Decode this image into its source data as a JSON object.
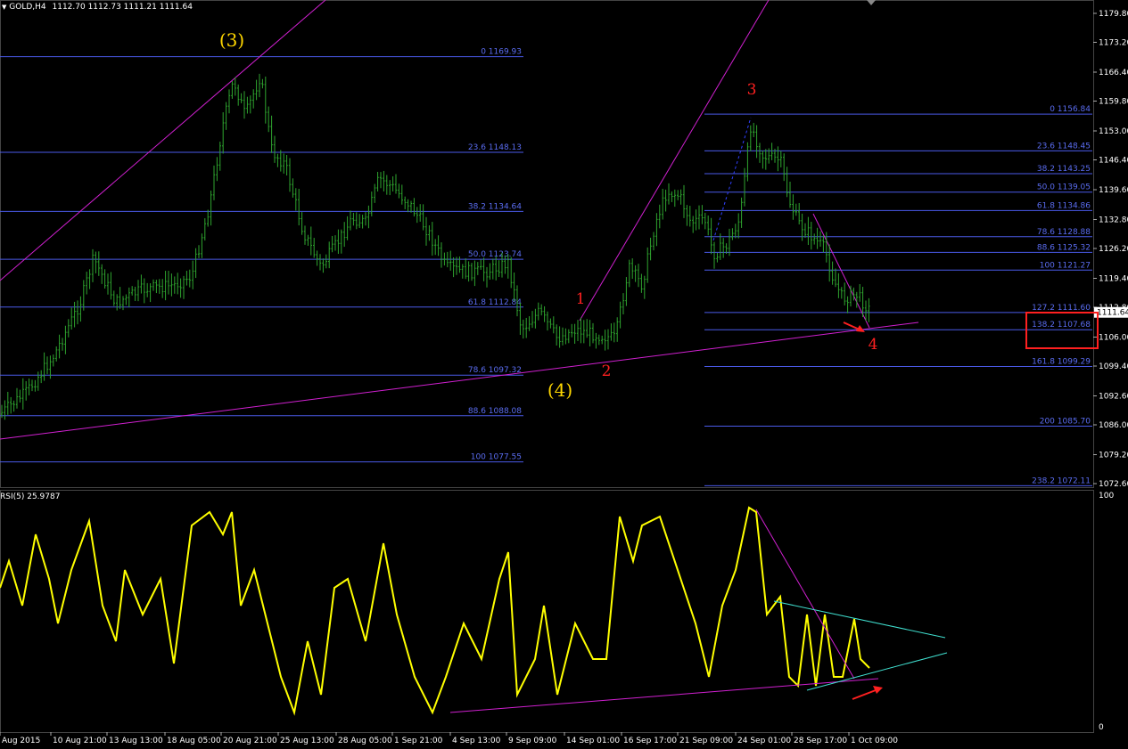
{
  "header": {
    "symbol": "GOLD,H4",
    "ohlc": "1112.70 1112.73 1111.21 1111.64"
  },
  "rsi_header": "RSI(5) 25.9787",
  "colors": {
    "background": "#000000",
    "candle": "#2fa52f",
    "fib": "#4a5ae8",
    "trend": "#d020d0",
    "rsi": "#ffff00",
    "rsi_trend2": "#40e0d0",
    "annotation": "#ff2020",
    "wave_label": "#ffd700"
  },
  "price_axis": [
    "1179.80",
    "1173.20",
    "1166.40",
    "1159.80",
    "1153.00",
    "1146.40",
    "1139.60",
    "1132.80",
    "1126.20",
    "1119.40",
    "1112.80",
    "1106.00",
    "1099.40",
    "1092.60",
    "1086.00",
    "1079.20",
    "1072.60"
  ],
  "current_price_tag": "1111.64",
  "rsi_axis": [
    "100",
    "0"
  ],
  "time_axis": [
    "Aug 2015",
    "10 Aug 21:00",
    "13 Aug 13:00",
    "18 Aug 05:00",
    "20 Aug 21:00",
    "25 Aug 13:00",
    "28 Aug 05:00",
    "1 Sep 21:00",
    "4 Sep 13:00",
    "9 Sep 09:00",
    "14 Sep 01:00",
    "16 Sep 17:00",
    "21 Sep 09:00",
    "24 Sep 01:00",
    "28 Sep 17:00",
    "1 Oct 09:00"
  ],
  "fib_left": [
    {
      "label": "0 1169.93",
      "price": 1169.93
    },
    {
      "label": "23.6 1148.13",
      "price": 1148.13
    },
    {
      "label": "38.2 1134.64",
      "price": 1134.64
    },
    {
      "label": "50.0 1123.74",
      "price": 1123.74
    },
    {
      "label": "61.8 1112.84",
      "price": 1112.84
    },
    {
      "label": "78.6 1097.32",
      "price": 1097.32
    },
    {
      "label": "88.6 1088.08",
      "price": 1088.08
    },
    {
      "label": "100 1077.55",
      "price": 1077.55
    }
  ],
  "fib_right": [
    {
      "label": "0 1156.84",
      "price": 1156.84
    },
    {
      "label": "23.6 1148.45",
      "price": 1148.45
    },
    {
      "label": "38.2 1143.25",
      "price": 1143.25
    },
    {
      "label": "50.0 1139.05",
      "price": 1139.05
    },
    {
      "label": "61.8 1134.86",
      "price": 1134.86
    },
    {
      "label": "78.6 1128.88",
      "price": 1128.88
    },
    {
      "label": "88.6 1125.32",
      "price": 1125.32
    },
    {
      "label": "100 1121.27",
      "price": 1121.27
    },
    {
      "label": "127.2 1111.60",
      "price": 1111.6
    },
    {
      "label": "138.2 1107.68",
      "price": 1107.68
    },
    {
      "label": "161.8 1099.29",
      "price": 1099.29
    },
    {
      "label": "200 1085.70",
      "price": 1085.7
    },
    {
      "label": "238.2 1072.11",
      "price": 1072.11
    }
  ],
  "wave_labels": [
    {
      "text": "(3)",
      "style": "yellow"
    },
    {
      "text": "(4)",
      "style": "yellow"
    },
    {
      "text": "1",
      "style": "red"
    },
    {
      "text": "2",
      "style": "red"
    },
    {
      "text": "3",
      "style": "red"
    },
    {
      "text": "4",
      "style": "red"
    }
  ],
  "chart_data": {
    "type": "line",
    "title": "GOLD,H4",
    "ylim": [
      1069,
      1183
    ],
    "x_categories": [
      "Aug 2015",
      "10 Aug 21:00",
      "13 Aug 13:00",
      "18 Aug 05:00",
      "20 Aug 21:00",
      "25 Aug 13:00",
      "28 Aug 05:00",
      "1 Sep 21:00",
      "4 Sep 13:00",
      "9 Sep 09:00",
      "14 Sep 01:00",
      "16 Sep 17:00",
      "21 Sep 09:00",
      "24 Sep 01:00",
      "28 Sep 17:00",
      "1 Oct 09:00"
    ],
    "series": [
      {
        "name": "GOLD,H4",
        "values": [
          1085.0,
          1110.0,
          1125.0,
          1118.0,
          1125.0,
          1165.0,
          1142.0,
          1128.0,
          1146.0,
          1124.0,
          1112.0,
          1098.0,
          1110.0,
          1122.0,
          1140.0,
          1135.0,
          1125.0,
          1156.5,
          1146.0,
          1128.0,
          1116.0,
          1111.64
        ]
      },
      {
        "name": "RSI(5)",
        "values": [
          60,
          85,
          80,
          70,
          88,
          35,
          65,
          50,
          82,
          20,
          55,
          40,
          85,
          35,
          92,
          50,
          45,
          60,
          40,
          55,
          25.9787
        ]
      }
    ],
    "rsi_ylim": [
      0,
      100
    ],
    "grid": false,
    "legend": "none"
  }
}
